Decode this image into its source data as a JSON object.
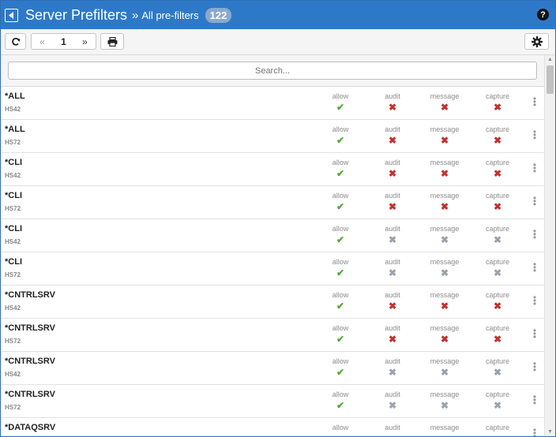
{
  "header": {
    "title": "Server Prefilters",
    "separator": "»",
    "subtitle": "All pre-filters",
    "count": "122",
    "help": "?"
  },
  "toolbar": {
    "refresh_icon": "refresh-icon",
    "pager_first": "«",
    "page": "1",
    "pager_next": "»",
    "print_icon": "print-icon",
    "settings_icon": "gear-icon"
  },
  "search": {
    "placeholder": "Search..."
  },
  "columns": [
    "allow",
    "audit",
    "message",
    "capture"
  ],
  "rows": [
    {
      "name": "*ALL",
      "system": "HS42",
      "allow": "✔",
      "audit": "✖",
      "message": "✖",
      "capture": "✖",
      "states": [
        "ok",
        "no",
        "no",
        "no"
      ]
    },
    {
      "name": "*ALL",
      "system": "HS72",
      "allow": "✔",
      "audit": "✖",
      "message": "✖",
      "capture": "✖",
      "states": [
        "ok",
        "no",
        "no",
        "no"
      ]
    },
    {
      "name": "*CLI",
      "system": "HS42",
      "allow": "✔",
      "audit": "✖",
      "message": "✖",
      "capture": "✖",
      "states": [
        "ok",
        "no",
        "no",
        "no"
      ]
    },
    {
      "name": "*CLI",
      "system": "HS72",
      "allow": "✔",
      "audit": "✖",
      "message": "✖",
      "capture": "✖",
      "states": [
        "ok",
        "no",
        "no",
        "no"
      ]
    },
    {
      "name": "*CLI",
      "system": "HS42",
      "allow": "✔",
      "audit": "✖",
      "message": "✖",
      "capture": "✖",
      "states": [
        "ok",
        "na",
        "na",
        "na"
      ]
    },
    {
      "name": "*CLI",
      "system": "HS72",
      "allow": "✔",
      "audit": "✖",
      "message": "✖",
      "capture": "✖",
      "states": [
        "ok",
        "na",
        "na",
        "na"
      ]
    },
    {
      "name": "*CNTRLSRV",
      "system": "HS42",
      "allow": "✔",
      "audit": "✖",
      "message": "✖",
      "capture": "✖",
      "states": [
        "ok",
        "no",
        "no",
        "no"
      ]
    },
    {
      "name": "*CNTRLSRV",
      "system": "HS72",
      "allow": "✔",
      "audit": "✖",
      "message": "✖",
      "capture": "✖",
      "states": [
        "ok",
        "no",
        "no",
        "no"
      ]
    },
    {
      "name": "*CNTRLSRV",
      "system": "HS42",
      "allow": "✔",
      "audit": "✖",
      "message": "✖",
      "capture": "✖",
      "states": [
        "ok",
        "na",
        "na",
        "na"
      ]
    },
    {
      "name": "*CNTRLSRV",
      "system": "HS72",
      "allow": "✔",
      "audit": "✖",
      "message": "✖",
      "capture": "✖",
      "states": [
        "ok",
        "na",
        "na",
        "na"
      ]
    },
    {
      "name": "*DATAQSRV",
      "system": "",
      "allow": "",
      "audit": "",
      "message": "",
      "capture": "",
      "states": [
        "",
        "",
        "",
        ""
      ]
    }
  ],
  "status_colors": {
    "ok": "#56a53a",
    "no": "#c62f2f",
    "na": "#9aa3ad",
    "accent": "#2e79c7"
  }
}
